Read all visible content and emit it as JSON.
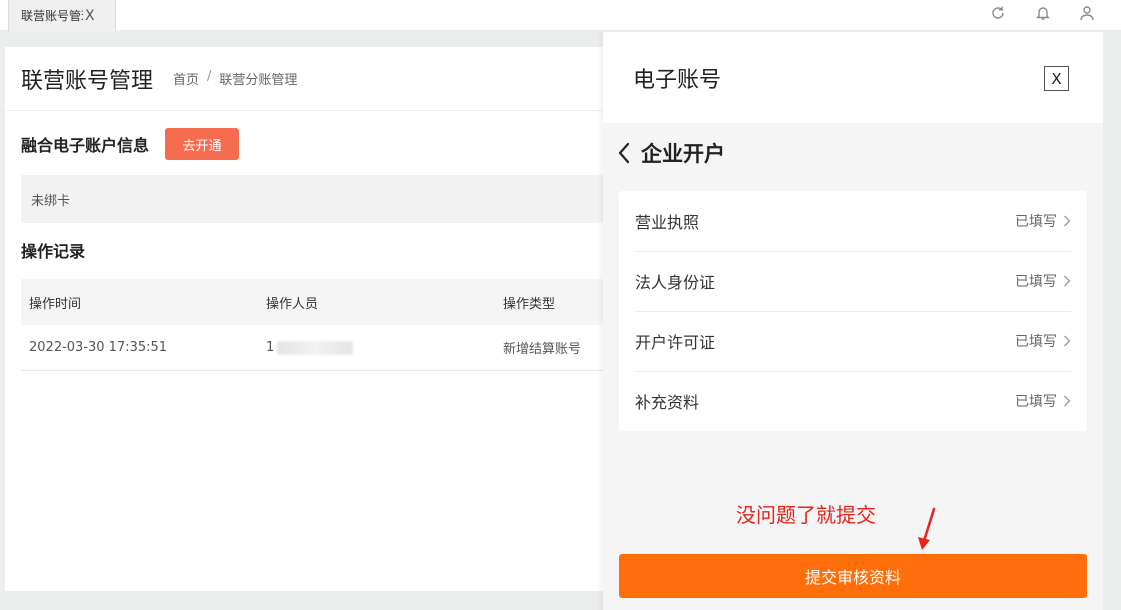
{
  "tabbar": {
    "tab_label": "联营账号管理",
    "tab_close": "X"
  },
  "page": {
    "title": "联营账号管理",
    "breadcrumb": [
      "首页",
      "/",
      "联营分账管理"
    ],
    "account_section_title": "融合电子账户信息",
    "open_button_label": "去开通",
    "card_status": "未绑卡",
    "ops_title": "操作记录",
    "table": {
      "headers": [
        "操作时间",
        "操作人员",
        "操作类型"
      ],
      "rows": [
        {
          "time": "2022-03-30 17:35:51",
          "operator": "1",
          "type": "新增结算账号"
        }
      ]
    }
  },
  "drawer": {
    "title": "电子账号",
    "close_label": "X",
    "sub_title": "企业开户",
    "items": [
      {
        "label": "营业执照",
        "status": "已填写"
      },
      {
        "label": "法人身份证",
        "status": "已填写"
      },
      {
        "label": "开户许可证",
        "status": "已填写"
      },
      {
        "label": "补充资料",
        "status": "已填写"
      }
    ],
    "annotation": "没问题了就提交",
    "submit_label": "提交审核资料"
  },
  "colors": {
    "open_button": "#f56c4f",
    "submit_button": "#ff6e0a",
    "annotation": "#e8231c"
  },
  "icons": [
    "refresh-icon",
    "bell-icon",
    "user-icon",
    "chevron-left-icon",
    "chevron-right-icon",
    "close-icon"
  ]
}
